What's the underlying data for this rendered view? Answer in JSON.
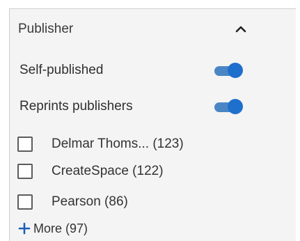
{
  "facet": {
    "title": "Publisher",
    "collapse_icon": "chevron-up-icon",
    "toggles": [
      {
        "label": "Self-published",
        "on": true
      },
      {
        "label": "Reprints publishers",
        "on": true
      }
    ],
    "options": [
      {
        "label": "Delmar Thoms...  (123)",
        "checked": false
      },
      {
        "label": "CreateSpace (122)",
        "checked": false
      },
      {
        "label": "Pearson (86)",
        "checked": false
      }
    ],
    "more": {
      "icon": "plus-icon",
      "label": "More (97)"
    }
  },
  "colors": {
    "accent": "#1f6fcc",
    "track": "#4a86c5",
    "panel_bg": "#f4f4f4"
  }
}
